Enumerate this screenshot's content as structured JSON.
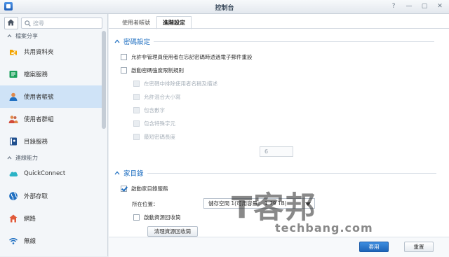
{
  "window": {
    "title": "控制台"
  },
  "sidebar": {
    "search_placeholder": "搜尋",
    "sections": [
      {
        "label": "檔案分享"
      },
      {
        "label": "連線能力"
      }
    ],
    "items": [
      {
        "label": "共用資料夾",
        "icon": "shared-folder-icon"
      },
      {
        "label": "檔案服務",
        "icon": "file-services-icon"
      },
      {
        "label": "使用者帳號",
        "icon": "user-icon"
      },
      {
        "label": "使用者群組",
        "icon": "user-group-icon"
      },
      {
        "label": "目錄服務",
        "icon": "directory-icon"
      },
      {
        "label": "QuickConnect",
        "icon": "quickconnect-icon"
      },
      {
        "label": "外部存取",
        "icon": "globe-icon"
      },
      {
        "label": "網路",
        "icon": "network-icon"
      },
      {
        "label": "無線",
        "icon": "wireless-icon"
      }
    ]
  },
  "tabs": [
    {
      "label": "使用者帳號"
    },
    {
      "label": "進階設定"
    }
  ],
  "password": {
    "heading": "密碼設定",
    "allow_reset": "允許非管理員使用者在忘記密碼時透過電子郵件重設",
    "enforce_rules": "啟動密碼強度限制規則",
    "rules": [
      "在密碼中排除使用者名稱及描述",
      "允許混合大小寫",
      "包含數字",
      "包含特殊字元",
      "最短密碼長度"
    ],
    "min_length": "6"
  },
  "home": {
    "heading": "家目錄",
    "enable_label": "啟動家目錄服務",
    "location_label": "所在位置：",
    "location_value": "儲存空間 1(可用容量： 1.79 TB)",
    "recycle_label": "啟動資源回收筒",
    "empty_button": "清理資源回收筒"
  },
  "footer": {
    "apply": "套用",
    "reset": "重置"
  },
  "watermark": {
    "main": "T客邦",
    "sub": "techbang.com"
  },
  "colors": {
    "accent": "#1f6fc1",
    "selected_bg": "#cfe3f7",
    "primary_button": "#2a78cf"
  }
}
